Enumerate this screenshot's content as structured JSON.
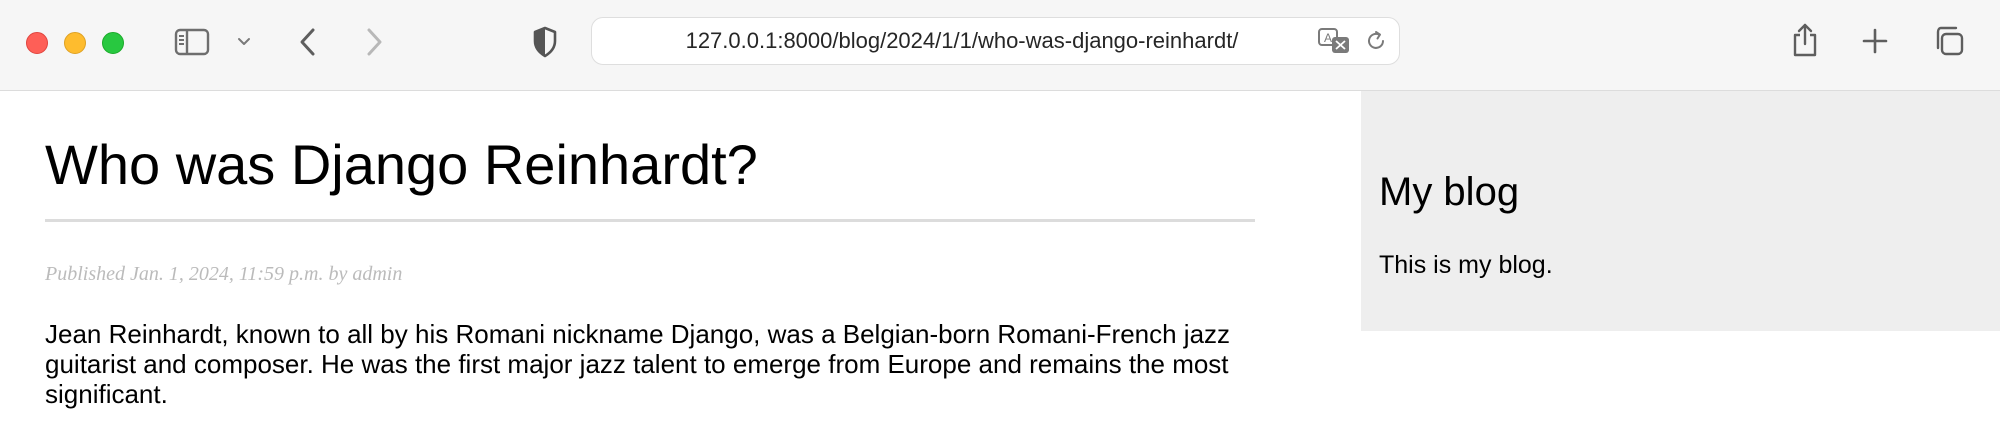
{
  "browser": {
    "url": "127.0.0.1:8000/blog/2024/1/1/who-was-django-reinhardt/",
    "icons": {
      "sidebar_toggle": "sidebar-icon",
      "tab_overview_menu": "chevron-down-icon",
      "back": "chevron-left-icon",
      "forward": "chevron-right-icon",
      "privacy": "shield-icon",
      "translate": "translate-icon",
      "reload": "reload-icon",
      "share": "share-icon",
      "new_tab": "plus-icon",
      "tabs": "tabs-overview-icon"
    },
    "window_controls": {
      "close": "#fe5f57",
      "minimize": "#febc2e",
      "maximize": "#28c840"
    }
  },
  "post": {
    "title": "Who was Django Reinhardt?",
    "date_line": "Published Jan. 1, 2024, 11:59 p.m. by admin",
    "body": "Jean Reinhardt, known to all by his Romani nickname Django, was a Belgian-born Romani-French jazz guitarist and composer. He was the first major jazz talent to emerge from Europe and remains the most significant."
  },
  "sidebar": {
    "title": "My blog",
    "description": "This is my blog."
  }
}
